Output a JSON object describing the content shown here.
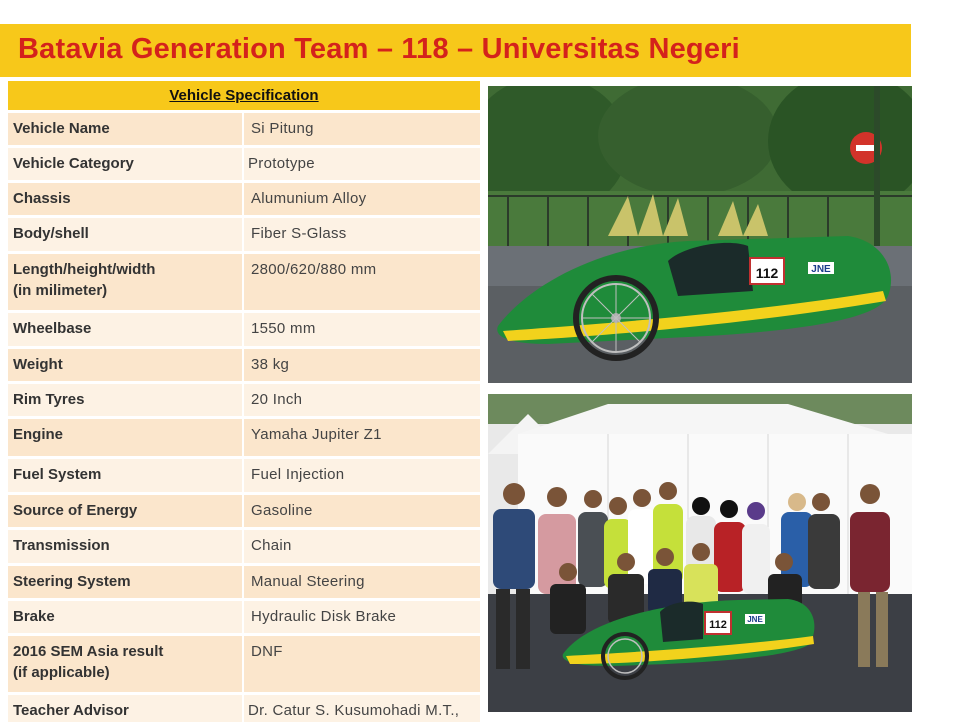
{
  "slide": {
    "title": "Batavia Generation Team – 118 – Universitas Negeri"
  },
  "spec": {
    "header": "Vehicle Specification",
    "rows": [
      {
        "label": "Vehicle Name",
        "value": "Si Pitung"
      },
      {
        "label": "Vehicle Category",
        "value": "Prototype"
      },
      {
        "label": "Chassis",
        "value": "Alumunium  Alloy"
      },
      {
        "label": "Body/shell",
        "value": "Fiber S-Glass"
      },
      {
        "label": "Length/height/width",
        "label2": "(in milimeter)",
        "value": "2800/620/880  mm"
      },
      {
        "label": "Wheelbase",
        "value": "1550   mm"
      },
      {
        "label": "Weight",
        "value": "38 kg"
      },
      {
        "label": "Rim Tyres",
        "value": "20   Inch"
      },
      {
        "label": "Engine",
        "value": "Yamaha  Jupiter Z1"
      },
      {
        "label": "Fuel System",
        "value": "Fuel Injection"
      },
      {
        "label": "Source  of Energy",
        "value": "Gasoline"
      },
      {
        "label": "Transmission",
        "value": "Chain"
      },
      {
        "label": "Steering System",
        "value": "Manual  Steering"
      },
      {
        "label": "Brake",
        "value": "Hydraulic Disk Brake"
      },
      {
        "label": "2016 SEM Asia result",
        "label2": "(if applicable)",
        "value": "DNF"
      },
      {
        "label": "Teacher Advisor",
        "value": "Dr. Catur  S.  Kusumohadi  M.T.,"
      }
    ]
  },
  "photos": {
    "car": {
      "number": "112",
      "sponsor": "JNE"
    },
    "team": {
      "number": "112",
      "sponsor": "JNE"
    }
  }
}
